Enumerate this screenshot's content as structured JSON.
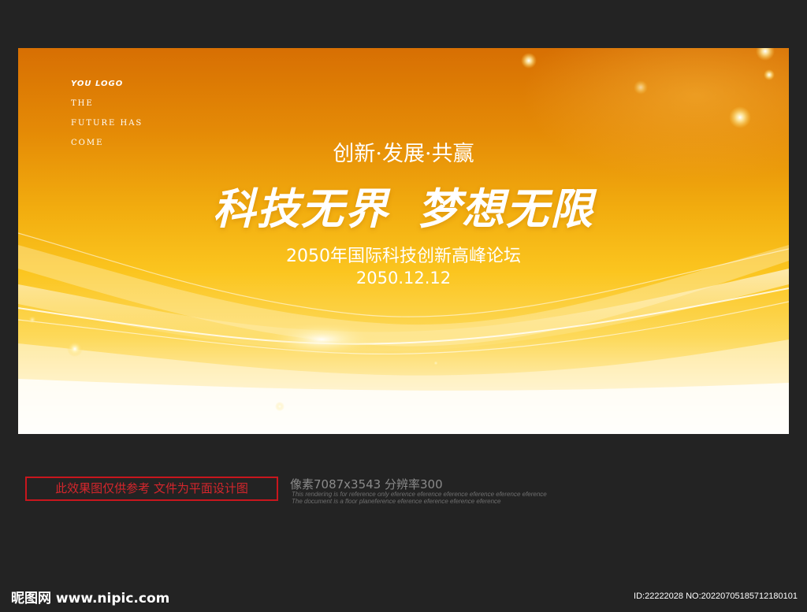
{
  "banner": {
    "logo": "YOU LOGO",
    "tagline": [
      "THE",
      "FUTURE HAS",
      "COME"
    ],
    "subtitle": "创新·发展·共赢",
    "headline_left": "科技无界",
    "headline_right": "梦想无限",
    "forum_name": "2050年国际科技创新高峰论坛",
    "forum_date": "2050.12.12",
    "colors": {
      "top": "#d76f03",
      "middle": "#fbc51f",
      "bottom": "#ffffff"
    }
  },
  "footer": {
    "notice": "此效果图仅供参考 文件为平面设计图",
    "spec": "像素7087x3543  分辨率300",
    "spec_note_1": "This rendering is for reference only  eference eference eference eference eference eference",
    "spec_note_2": "The document is a floor planeference eference eference eference eference",
    "watermark": "昵图网 www.nipic.com",
    "image_id": "ID:22222028 NO:20220705185712180101"
  }
}
